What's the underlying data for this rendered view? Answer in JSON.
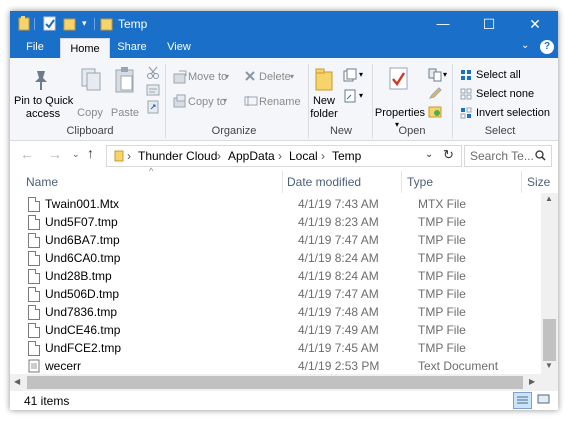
{
  "window": {
    "title": "Temp",
    "controls": {
      "minimize": "—",
      "maximize": "☐",
      "close": "✕"
    }
  },
  "ribbon_tabs": [
    {
      "label": "File"
    },
    {
      "label": "Home"
    },
    {
      "label": "Share"
    },
    {
      "label": "View"
    }
  ],
  "ribbon": {
    "clipboard": {
      "label": "Clipboard",
      "pin_line1": "Pin to Quick",
      "pin_line2": "access",
      "copy": "Copy",
      "paste": "Paste"
    },
    "organize": {
      "label": "Organize",
      "move_to": "Move to",
      "copy_to": "Copy to",
      "delete": "Delete",
      "rename": "Rename"
    },
    "new": {
      "label": "New",
      "new_folder_line1": "New",
      "new_folder_line2": "folder"
    },
    "open": {
      "label": "Open",
      "properties": "Properties"
    },
    "select": {
      "label": "Select",
      "select_all": "Select all",
      "select_none": "Select none",
      "invert_selection": "Invert selection"
    }
  },
  "nav": {
    "breadcrumb": [
      "Thunder Cloud",
      "AppData",
      "Local",
      "Temp"
    ],
    "search_placeholder": "Search Te..."
  },
  "columns": {
    "name": "Name",
    "date_modified": "Date modified",
    "type": "Type",
    "size": "Size"
  },
  "files": [
    {
      "name": "Twain001.Mtx",
      "date": "4/1/19 7:43 AM",
      "type": "MTX File"
    },
    {
      "name": "Und5F07.tmp",
      "date": "4/1/19 8:23 AM",
      "type": "TMP File"
    },
    {
      "name": "Und6BA7.tmp",
      "date": "4/1/19 7:47 AM",
      "type": "TMP File"
    },
    {
      "name": "Und6CA0.tmp",
      "date": "4/1/19 8:24 AM",
      "type": "TMP File"
    },
    {
      "name": "Und28B.tmp",
      "date": "4/1/19 8:24 AM",
      "type": "TMP File"
    },
    {
      "name": "Und506D.tmp",
      "date": "4/1/19 7:47 AM",
      "type": "TMP File"
    },
    {
      "name": "Und7836.tmp",
      "date": "4/1/19 7:48 AM",
      "type": "TMP File"
    },
    {
      "name": "UndCE46.tmp",
      "date": "4/1/19 7:49 AM",
      "type": "TMP File"
    },
    {
      "name": "UndFCE2.tmp",
      "date": "4/1/19 7:45 AM",
      "type": "TMP File"
    },
    {
      "name": "wecerr",
      "date": "4/1/19 2:53 PM",
      "type": "Text Document"
    }
  ],
  "status": {
    "item_count": "41 items"
  },
  "colors": {
    "accent": "#1a6fc9",
    "header_text": "#4c607a"
  }
}
